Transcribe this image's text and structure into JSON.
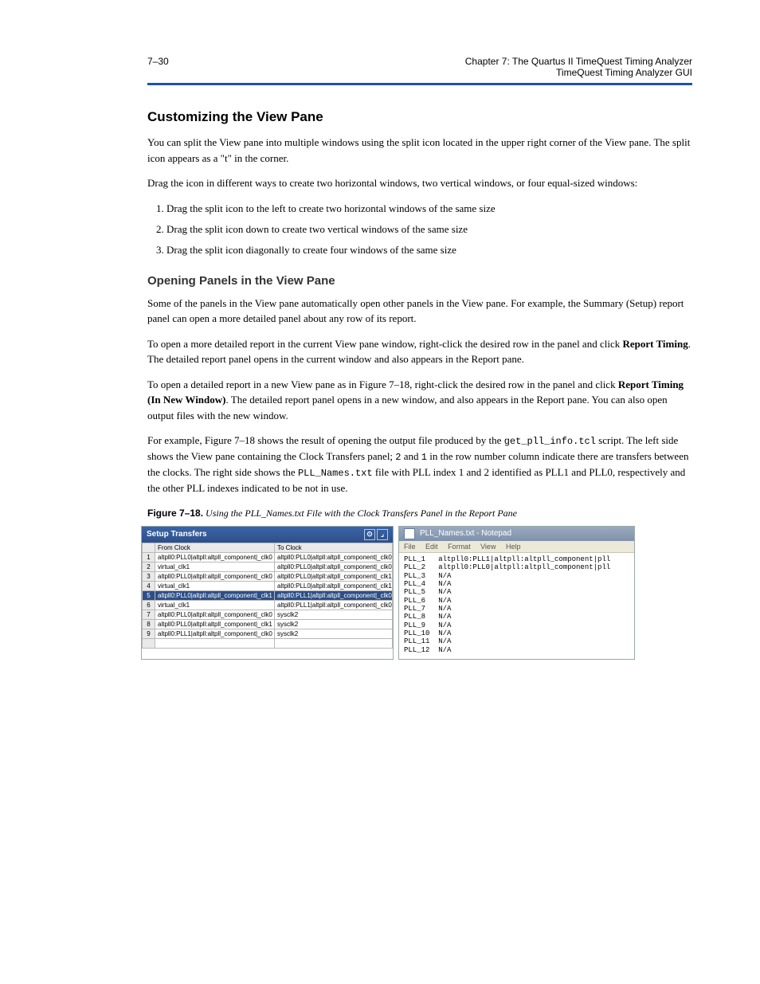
{
  "header": {
    "left": "7–30",
    "right": "Chapter 7: The Quartus II TimeQuest Timing Analyzer\nTimeQuest Timing Analyzer GUI"
  },
  "s1_title": "Customizing the View Pane",
  "s1_p1": "You can split the View pane into multiple windows using the split icon located in the upper right corner of the View pane. The split icon appears as a \"t\" in the corner.",
  "s1_p2": "Drag the icon in different ways to create two horizontal windows, two vertical windows, or four equal-sized windows:",
  "s1_li1": "Drag the split icon to the left to create two horizontal windows of the same size",
  "s1_li2": "Drag the split icon down to create two vertical windows of the same size",
  "s1_li3": "Drag the split icon diagonally to create four windows of the same size",
  "s2_title": "Opening Panels in the View Pane",
  "s2_p1": "Some of the panels in the View pane automatically open other panels in the View pane. For example, the Summary (Setup) report panel can open a more detailed panel about any row of its report.",
  "s2_p2_1": "To open a more detailed report in the current View pane window, right-click the desired row in the panel and click ",
  "s2_p2_bold": "Report Timing",
  "s2_p2_2": ". The detailed report panel opens in the current window and also appears in the Report pane.",
  "s2_p3_1": "To open a detailed report in a new View pane as in Figure 7–18, right-click the desired row in the panel and click ",
  "s2_p3_bold": "Report Timing (In New Window)",
  "s2_p3_2": ". The detailed report panel opens in a new window, and also appears in the Report pane. You can also open output files with the new window.",
  "s2_p4_1": "For example, Figure 7–18 shows the result of opening the output file produced by the ",
  "s2_p4_mono": "get_pll_info.tcl",
  "s2_p4_2": " script. The left side shows the View pane containing the Clock Transfers panel; ",
  "s2_p4_3": " and ",
  "s2_p4_4": " in the row number column indicate there are transfers between the clocks. The right side shows the ",
  "s2_p4_mono2": "PLL_Names.txt",
  "s2_p4_5": " file with PLL index 1 and 2 identified as PLL1 and PLL0, respectively and the other PLL indexes indicated to be not in use.",
  "s2_code1": "2",
  "s2_code2": "1",
  "caption_label": "Figure 7–18.",
  "caption_rest": " Using the PLL_Names.txt File with the Clock Transfers Panel in the Report Pane",
  "panel_left": {
    "title": "Setup Transfers",
    "col1": "From Clock",
    "col2": "To Clock",
    "rows": [
      {
        "n": "1",
        "from": "altpll0:PLL0|altpll:altpll_component|_clk0",
        "to": "altpll0:PLL0|altpll:altpll_component|_clk0",
        "sel": false
      },
      {
        "n": "2",
        "from": "virtual_clk1",
        "to": "altpll0:PLL0|altpll:altpll_component|_clk0",
        "sel": false
      },
      {
        "n": "3",
        "from": "altpll0:PLL0|altpll:altpll_component|_clk0",
        "to": "altpll0:PLL0|altpll:altpll_component|_clk1",
        "sel": false
      },
      {
        "n": "4",
        "from": "virtual_clk1",
        "to": "altpll0:PLL0|altpll:altpll_component|_clk1",
        "sel": false
      },
      {
        "n": "5",
        "from": "altpll0:PLL0|altpll:altpll_component|_clk1",
        "to": "altpll0:PLL1|altpll:altpll_component|_clk0",
        "sel": true
      },
      {
        "n": "6",
        "from": "virtual_clk1",
        "to": "altpll0:PLL1|altpll:altpll_component|_clk0",
        "sel": false
      },
      {
        "n": "7",
        "from": "altpll0:PLL0|altpll:altpll_component|_clk0",
        "to": "sysclk2",
        "sel": false
      },
      {
        "n": "8",
        "from": "altpll0:PLL0|altpll:altpll_component|_clk1",
        "to": "sysclk2",
        "sel": false
      },
      {
        "n": "9",
        "from": "altpll0:PLL1|altpll:altpll_component|_clk0",
        "to": "sysclk2",
        "sel": false
      }
    ]
  },
  "panel_right": {
    "title": "PLL_Names.txt - Notepad",
    "menu": [
      "File",
      "Edit",
      "Format",
      "View",
      "Help"
    ],
    "lines": [
      "PLL_1   altpll0:PLL1|altpll:altpll_component|pll",
      "PLL_2   altpll0:PLL0|altpll:altpll_component|pll",
      "PLL_3   N/A",
      "PLL_4   N/A",
      "PLL_5   N/A",
      "PLL_6   N/A",
      "PLL_7   N/A",
      "PLL_8   N/A",
      "PLL_9   N/A",
      "PLL_10  N/A",
      "PLL_11  N/A",
      "PLL_12  N/A"
    ]
  }
}
